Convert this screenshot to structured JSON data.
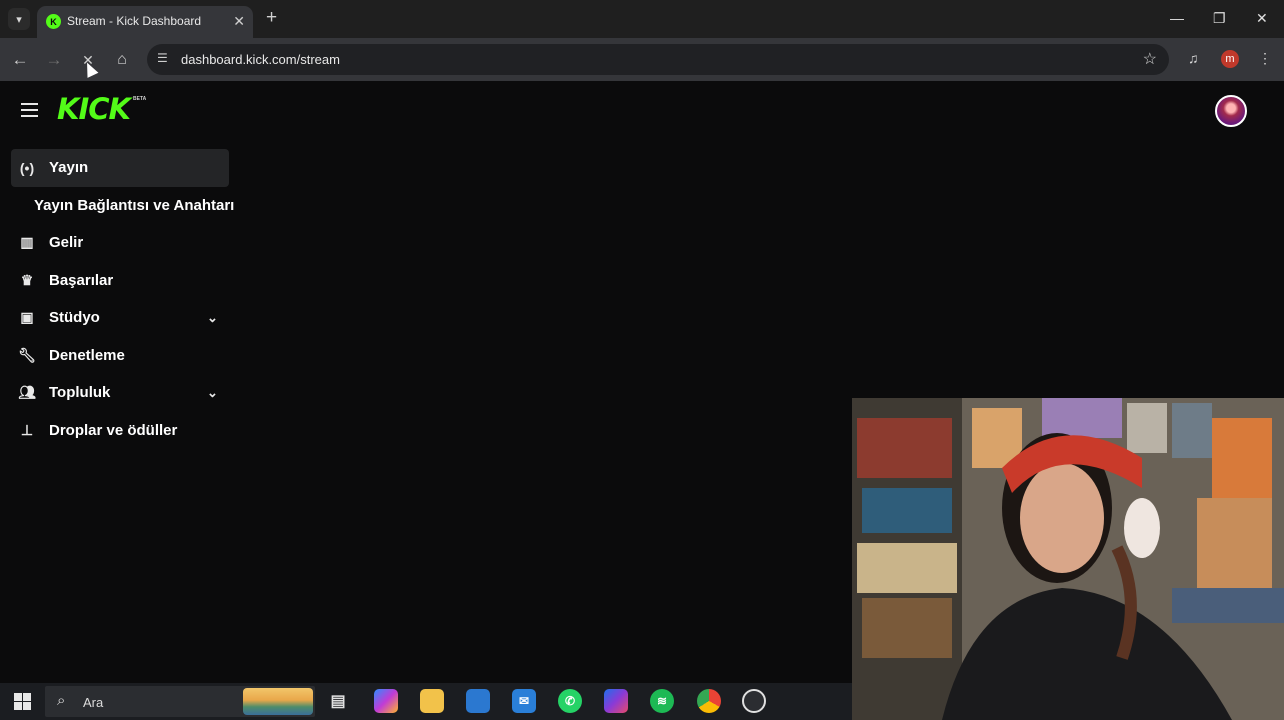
{
  "browser": {
    "tab_title": "Stream - Kick Dashboard",
    "url": "dashboard.kick.com/stream",
    "profile_letter": "m"
  },
  "page": {
    "logo_text": "KICK",
    "logo_badge": "BETA",
    "nav": [
      {
        "label": "Yayın",
        "icon": "broadcast-icon",
        "active": true
      },
      {
        "label": "Yayın Bağlantısı ve Anahtarı",
        "sub": true
      },
      {
        "label": "Gelir",
        "icon": "chart-icon"
      },
      {
        "label": "Başarılar",
        "icon": "trophy-icon"
      },
      {
        "label": "Stüdyo",
        "icon": "film-icon",
        "expandable": true
      },
      {
        "label": "Denetleme",
        "icon": "wrench-icon"
      },
      {
        "label": "Topluluk",
        "icon": "users-icon",
        "expandable": true
      },
      {
        "label": "Droplar ve ödüller",
        "icon": "gift-icon"
      }
    ]
  },
  "taskbar": {
    "search_placeholder": "Ara",
    "apps": [
      "task-view",
      "copilot",
      "file-explorer",
      "microsoft-store",
      "mail",
      "whatsapp",
      "m365",
      "spotify",
      "chrome",
      "obs"
    ]
  },
  "colors": {
    "accent": "#53fc18",
    "page_bg": "#0b0b0c",
    "chrome_bg": "#35363a"
  }
}
